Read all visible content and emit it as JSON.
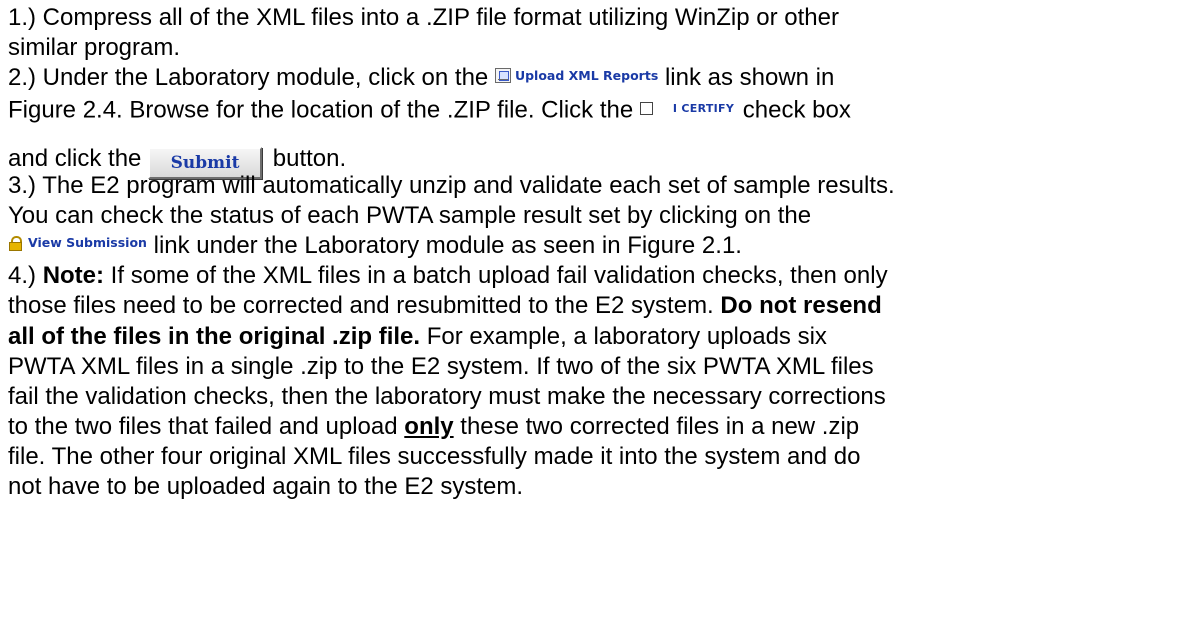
{
  "step1": {
    "line1": "1.) Compress all of the XML files into a .ZIP file format utilizing WinZip or other",
    "line2": "similar program."
  },
  "step2": {
    "before_upload": "2.) Under the Laboratory module, click on the",
    "upload_link_label": "Upload XML Reports",
    "after_upload": "link as shown in",
    "line2a": "Figure 2.4.  Browse for the location of the .ZIP file.  Click the",
    "certify_label": "I CERTIFY",
    "line2b": "check box",
    "line3a": "and click the",
    "submit_label": "Submit",
    "line3b": "button."
  },
  "step3": {
    "line1": "3.) The E2 program will automatically unzip and validate each set of sample results.",
    "line2": "You can check the status of each PWTA sample result set by clicking on the",
    "view_link_label": "View Submission",
    "line3": "link under the Laboratory module as seen in Figure 2.1."
  },
  "step4": {
    "l1_prefix": "4.) ",
    "l1_bold": "Note:",
    "l1_rest": " If some of the XML files in a batch upload fail validation checks, then only",
    "l2_plain": "those files need to be corrected and resubmitted to the E2 system.  ",
    "l2_bold": "Do not resend",
    "l3_bold": "all of the files in the original .zip file.",
    "l3_rest": "  For example, a laboratory uploads six",
    "l4": "PWTA XML files in a single .zip to the E2 system.  If two of the six PWTA XML files",
    "l5": "fail the validation checks, then the laboratory must make the necessary corrections",
    "l6_a": "to the two files that failed and upload ",
    "l6_only": "only",
    "l6_b": " these two corrected files in a new .zip",
    "l7": "file.  The other four original XML files successfully made it into the system and do",
    "l8": "not have to be uploaded again to the E2 system."
  },
  "icons": {
    "upload": "upload-xml-icon",
    "lock": "lock-icon"
  },
  "colors": {
    "link": "#1a3aa6",
    "text": "#000000"
  }
}
